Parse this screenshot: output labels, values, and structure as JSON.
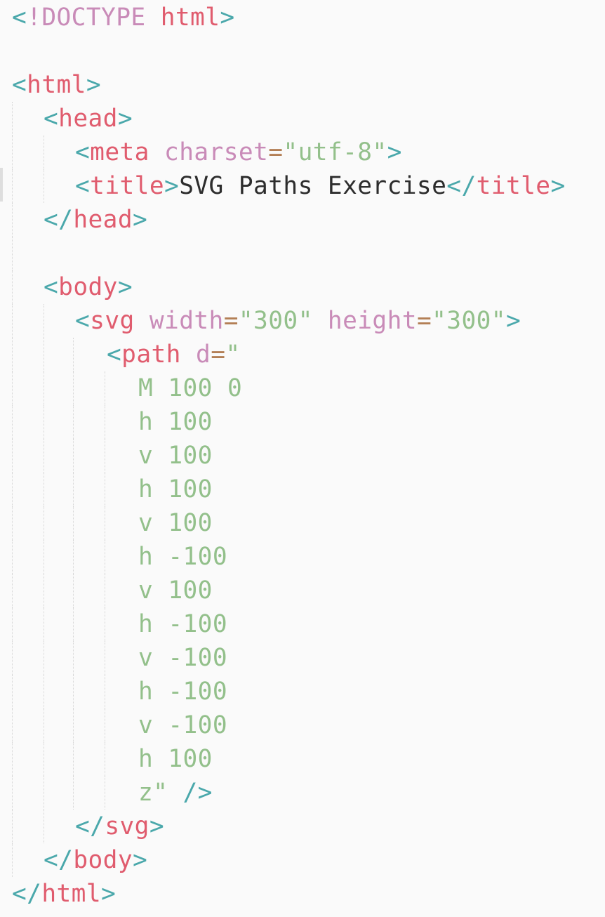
{
  "editor": {
    "doctype": {
      "open": "<",
      "bang": "!DOCTYPE",
      "name": "html",
      "close": ">"
    },
    "html_open": {
      "open": "<",
      "name": "html",
      "close": ">"
    },
    "head_open": {
      "open": "<",
      "name": "head",
      "close": ">"
    },
    "meta": {
      "open": "<",
      "name": "meta",
      "attr": "charset",
      "eq": "=",
      "value": "\"utf-8\"",
      "close": ">"
    },
    "title": {
      "open": "<",
      "name": "title",
      "close": ">",
      "text": "SVG Paths Exercise",
      "end_open": "</",
      "end_name": "title",
      "end_close": ">"
    },
    "head_close": {
      "open": "</",
      "name": "head",
      "close": ">"
    },
    "body_open": {
      "open": "<",
      "name": "body",
      "close": ">"
    },
    "svg": {
      "open": "<",
      "name": "svg",
      "attr1": "width",
      "eq1": "=",
      "val1": "\"300\"",
      "attr2": "height",
      "eq2": "=",
      "val2": "\"300\"",
      "close": ">"
    },
    "path": {
      "open": "<",
      "name": "path",
      "attr": "d",
      "eq": "=",
      "quote": "\""
    },
    "path_commands": [
      "M 100 0",
      "h 100",
      "v 100",
      "h 100",
      "v 100",
      "h -100",
      "v 100",
      "h -100",
      "v -100",
      "h -100",
      "v -100",
      "h 100",
      "z\""
    ],
    "path_self_close": "/>",
    "svg_close": {
      "open": "</",
      "name": "svg",
      "close": ">"
    },
    "body_close": {
      "open": "</",
      "name": "body",
      "close": ">"
    },
    "html_close": {
      "open": "</",
      "name": "html",
      "close": ">"
    }
  },
  "colors": {
    "background": "#fafafa",
    "punctuation": "#4aa8ab",
    "keyword": "#c98bb8",
    "tag": "#e05c6e",
    "attribute": "#c98bb8",
    "equals": "#b37f55",
    "string": "#93c08b",
    "text": "#2d2d2d"
  }
}
